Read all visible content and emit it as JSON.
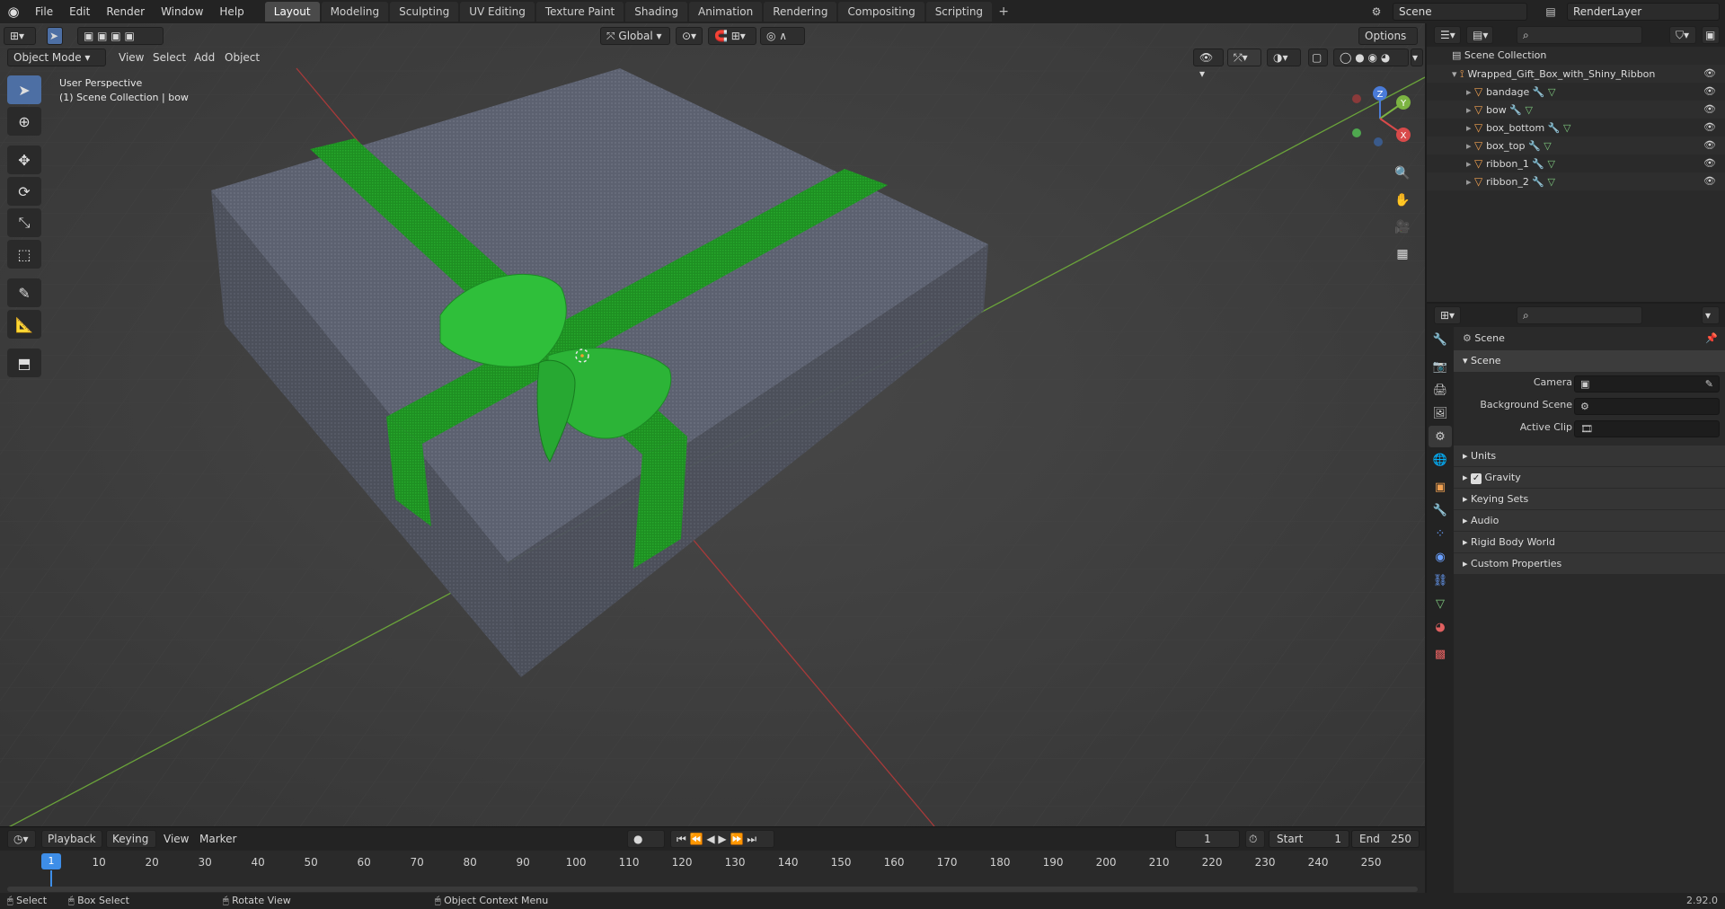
{
  "topbar": {
    "menus": [
      "File",
      "Edit",
      "Render",
      "Window",
      "Help"
    ],
    "workspaces": [
      "Layout",
      "Modeling",
      "Sculpting",
      "UV Editing",
      "Texture Paint",
      "Shading",
      "Animation",
      "Rendering",
      "Compositing",
      "Scripting"
    ],
    "active_workspace": "Layout",
    "scene_name": "Scene",
    "view_layer": "RenderLayer"
  },
  "viewport": {
    "mode": "Object Mode",
    "menus": [
      "View",
      "Select",
      "Add",
      "Object"
    ],
    "transform_orientation": "Global",
    "options_label": "Options",
    "view_name": "User Perspective",
    "context": "(1) Scene Collection | bow",
    "gizmo": {
      "x_label": "X",
      "y_label": "Y",
      "z_label": "Z"
    }
  },
  "timeline": {
    "menus": [
      "Playback",
      "Keying",
      "View",
      "Marker"
    ],
    "current_frame": "1",
    "start_label": "Start",
    "start_value": "1",
    "end_label": "End",
    "end_value": "250",
    "ticks": [
      "10",
      "20",
      "30",
      "40",
      "50",
      "60",
      "70",
      "80",
      "90",
      "100",
      "110",
      "120",
      "130",
      "140",
      "150",
      "160",
      "170",
      "180",
      "190",
      "200",
      "210",
      "220",
      "230",
      "240",
      "250"
    ]
  },
  "statusbar": {
    "select": "Select",
    "box_select": "Box Select",
    "rotate_view": "Rotate View",
    "context_menu": "Object Context Menu",
    "version": "2.92.0"
  },
  "outliner": {
    "root": "Scene Collection",
    "collection": "Wrapped_Gift_Box_with_Shiny_Ribbon",
    "objects": [
      "bandage",
      "bow",
      "box_bottom",
      "box_top",
      "ribbon_1",
      "ribbon_2"
    ]
  },
  "properties": {
    "header": "Scene",
    "panel": "Scene",
    "camera_label": "Camera",
    "background_label": "Background Scene",
    "clip_label": "Active Clip",
    "subpanels": [
      "Units",
      "Gravity",
      "Keying Sets",
      "Audio",
      "Rigid Body World",
      "Custom Properties"
    ]
  },
  "colors": {
    "accent": "#4d6fa4",
    "box": "#5a5f6e",
    "ribbon": "#1f9a24",
    "bow": "#2fc13a"
  }
}
